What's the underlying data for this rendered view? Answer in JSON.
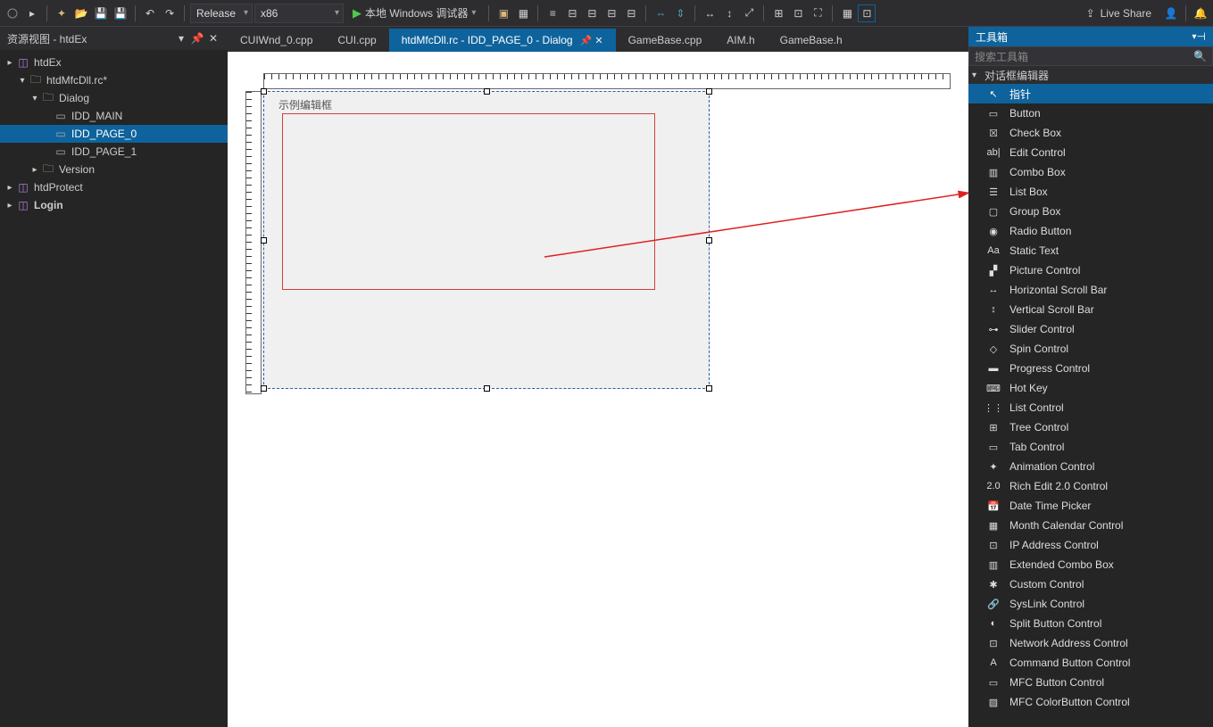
{
  "toolbar": {
    "config": "Release",
    "platform": "x86",
    "debugger": "本地 Windows 调试器",
    "liveShare": "Live Share"
  },
  "leftPanel": {
    "title": "资源视图 - htdEx",
    "tree": [
      {
        "level": 0,
        "arrow": "▸◂",
        "icon": "sln",
        "label": "htdEx",
        "selected": false
      },
      {
        "level": 1,
        "arrow": "▾",
        "icon": "folder",
        "label": "htdMfcDll.rc*",
        "selected": false
      },
      {
        "level": 2,
        "arrow": "▾",
        "icon": "folder",
        "label": "Dialog",
        "selected": false
      },
      {
        "level": 3,
        "arrow": "",
        "icon": "dlg",
        "label": "IDD_MAIN",
        "selected": false
      },
      {
        "level": 3,
        "arrow": "",
        "icon": "dlg",
        "label": "IDD_PAGE_0",
        "selected": true
      },
      {
        "level": 3,
        "arrow": "",
        "icon": "dlg",
        "label": "IDD_PAGE_1",
        "selected": false
      },
      {
        "level": 2,
        "arrow": "▸",
        "icon": "folder",
        "label": "Version",
        "selected": false
      },
      {
        "level": 0,
        "arrow": "▸",
        "icon": "sln",
        "label": "htdProtect",
        "selected": false
      },
      {
        "level": 0,
        "arrow": "▸",
        "icon": "sln",
        "label": "Login",
        "selected": false,
        "bold": true
      }
    ]
  },
  "tabs": [
    {
      "label": "CUIWnd_0.cpp",
      "active": false
    },
    {
      "label": "CUI.cpp",
      "active": false
    },
    {
      "label": "htdMfcDll.rc - IDD_PAGE_0 - Dialog",
      "active": true
    },
    {
      "label": "GameBase.cpp",
      "active": false
    },
    {
      "label": "AIM.h",
      "active": false
    },
    {
      "label": "GameBase.h",
      "active": false
    }
  ],
  "editor": {
    "editBoxLabel": "示例编辑框"
  },
  "toolbox": {
    "title": "工具箱",
    "search_placeholder": "搜索工具箱",
    "group": "对话框编辑器",
    "items": [
      {
        "icon": "ptr",
        "label": "指针",
        "selected": true
      },
      {
        "icon": "btn",
        "label": "Button"
      },
      {
        "icon": "chk",
        "label": "Check Box"
      },
      {
        "icon": "edit",
        "label": "Edit Control"
      },
      {
        "icon": "combo",
        "label": "Combo Box"
      },
      {
        "icon": "list",
        "label": "List Box"
      },
      {
        "icon": "grp",
        "label": "Group Box"
      },
      {
        "icon": "radio",
        "label": "Radio Button"
      },
      {
        "icon": "static",
        "label": "Static Text"
      },
      {
        "icon": "pic",
        "label": "Picture Control"
      },
      {
        "icon": "hsb",
        "label": "Horizontal Scroll Bar"
      },
      {
        "icon": "vsb",
        "label": "Vertical Scroll Bar"
      },
      {
        "icon": "slider",
        "label": "Slider Control"
      },
      {
        "icon": "spin",
        "label": "Spin Control"
      },
      {
        "icon": "prog",
        "label": "Progress Control"
      },
      {
        "icon": "hot",
        "label": "Hot Key"
      },
      {
        "icon": "listc",
        "label": "List Control"
      },
      {
        "icon": "tree",
        "label": "Tree Control"
      },
      {
        "icon": "tab",
        "label": "Tab Control"
      },
      {
        "icon": "anim",
        "label": "Animation Control"
      },
      {
        "icon": "rich",
        "label": "Rich Edit 2.0 Control"
      },
      {
        "icon": "date",
        "label": "Date Time Picker"
      },
      {
        "icon": "month",
        "label": "Month Calendar Control"
      },
      {
        "icon": "ip",
        "label": "IP Address Control"
      },
      {
        "icon": "xcombo",
        "label": "Extended Combo Box"
      },
      {
        "icon": "custom",
        "label": "Custom Control"
      },
      {
        "icon": "syslink",
        "label": "SysLink Control"
      },
      {
        "icon": "split",
        "label": "Split Button Control"
      },
      {
        "icon": "net",
        "label": "Network Address Control"
      },
      {
        "icon": "cmd",
        "label": "Command Button Control"
      },
      {
        "icon": "mfcbtn",
        "label": "MFC Button Control"
      },
      {
        "icon": "mfccolor",
        "label": "MFC ColorButton Control"
      }
    ]
  }
}
